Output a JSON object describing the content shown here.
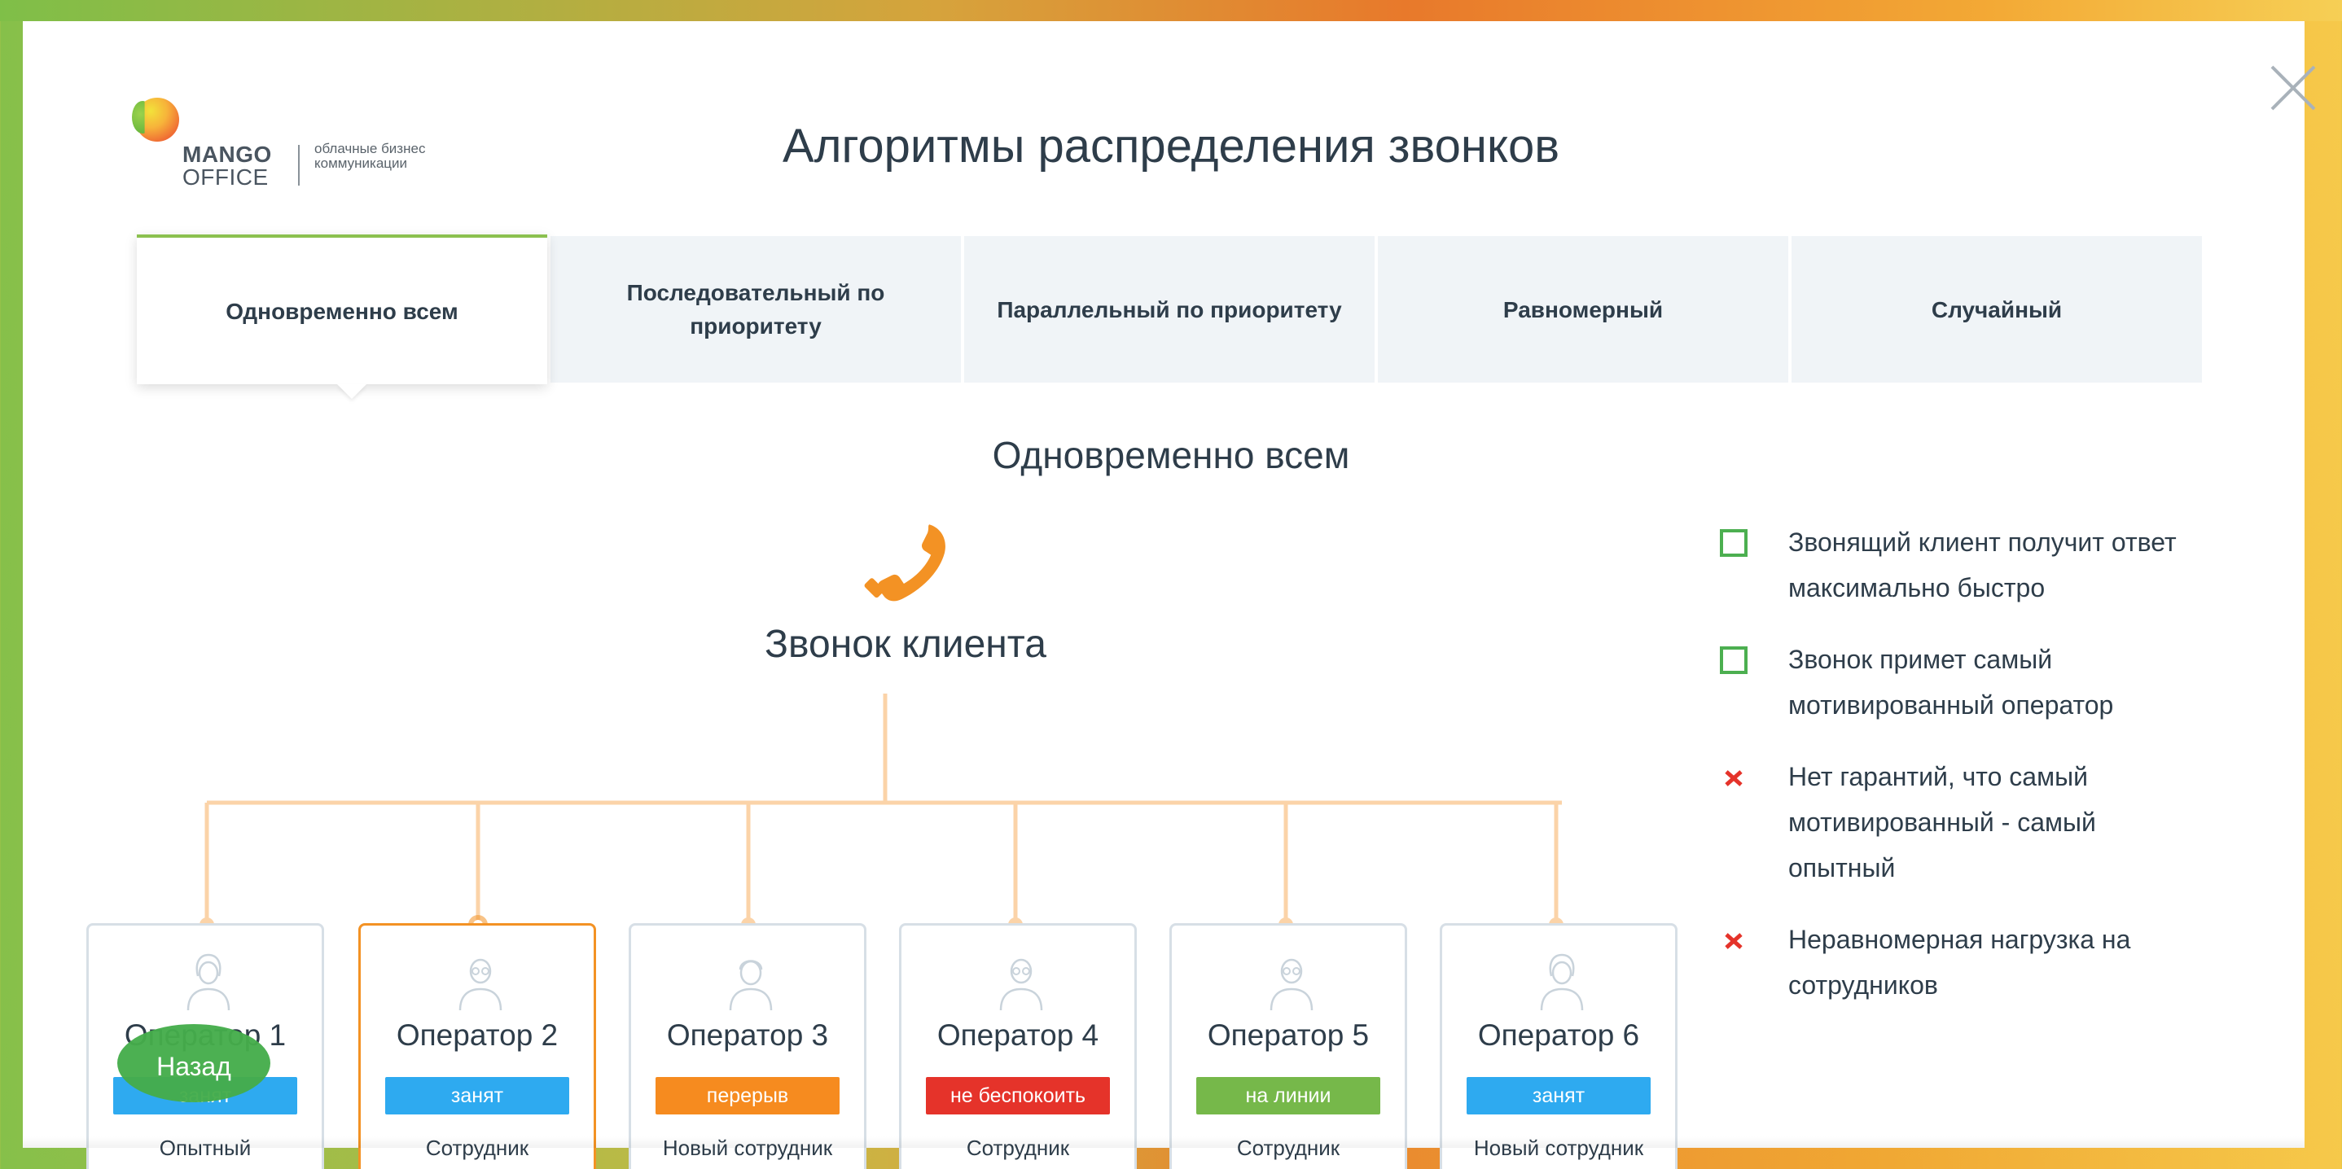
{
  "header": {
    "title": "Алгоритмы распределения звонков",
    "close_label": "Закрыть"
  },
  "logo": {
    "brand_line1": "MANGO",
    "brand_line2": "OFFICE",
    "tagline": "облачные бизнес коммуникации"
  },
  "tabs": [
    {
      "label": "Одновременно всем",
      "active": true
    },
    {
      "label": "Последовательный по приоритету",
      "active": false
    },
    {
      "label": "Параллельный по приоритету",
      "active": false
    },
    {
      "label": "Равномерный",
      "active": false
    },
    {
      "label": "Случайный",
      "active": false
    }
  ],
  "section": {
    "title": "Одновременно всем",
    "call_label": "Звонок клиента"
  },
  "colors": {
    "accent_green": "#8bc04f",
    "line_orange": "#fbd3a8",
    "busy_blue": "#2eaaf0",
    "break_orange": "#f68b1f",
    "dnd_red": "#e5332a",
    "online_green": "#76b84a",
    "highlight_orange": "#f39224",
    "text_dark": "#2e3d4a"
  },
  "operators": [
    {
      "name": "Оператор 1",
      "status": "занят",
      "status_color": "#2eaaf0",
      "role": "Опытный",
      "gender": "female"
    },
    {
      "name": "Оператор 2",
      "status": "занят",
      "status_color": "#2eaaf0",
      "role": "Сотрудник",
      "gender": "male-glasses",
      "highlighted": true
    },
    {
      "name": "Оператор 3",
      "status": "перерыв",
      "status_color": "#f68b1f",
      "role": "Новый сотрудник",
      "gender": "male"
    },
    {
      "name": "Оператор 4",
      "status": "не беспокоить",
      "status_color": "#e5332a",
      "role": "Сотрудник",
      "gender": "male-glasses"
    },
    {
      "name": "Оператор 5",
      "status": "на линии",
      "status_color": "#76b84a",
      "role": "Сотрудник",
      "gender": "male-glasses"
    },
    {
      "name": "Оператор 6",
      "status": "занят",
      "status_color": "#2eaaf0",
      "role": "Новый сотрудник",
      "gender": "female"
    }
  ],
  "back_button": {
    "label": "Назад"
  },
  "features": [
    {
      "text": "Звонящий клиент получит ответ максимально быстро",
      "type": "pro"
    },
    {
      "text": "Звонок примет самый мотивированный оператор",
      "type": "pro"
    },
    {
      "text": "Нет гарантий, что самый мотивированный - самый опытный",
      "type": "con"
    },
    {
      "text": "Неравномерная нагрузка на сотрудников",
      "type": "con"
    }
  ]
}
